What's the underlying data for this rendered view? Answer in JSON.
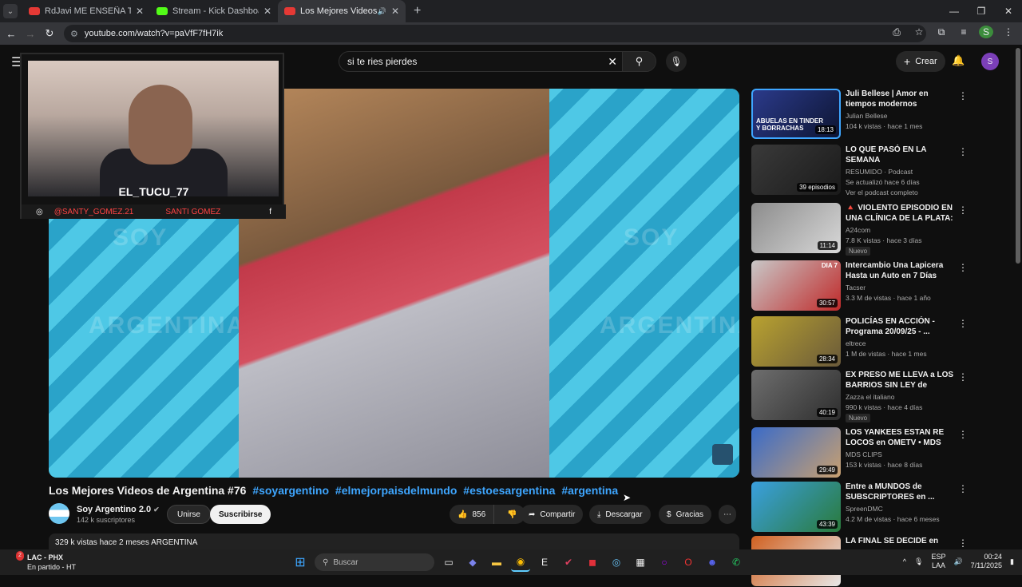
{
  "browser": {
    "tabs": [
      {
        "label": "RdJavi ME ENSEÑA TODA SU C...",
        "color": "#e53935"
      },
      {
        "label": "Stream - Kick Dashboard",
        "color": "#53fc18"
      },
      {
        "label": "Los Mejores Videos de Arg...",
        "color": "#e53935"
      }
    ],
    "url": "youtube.com/watch?v=paVfF7fH7ik",
    "profile": "S"
  },
  "yt": {
    "search_value": "si te ries pierdes",
    "create_label": "Crear",
    "user_initial": "S"
  },
  "overlay": {
    "nickname": "EL_TUCU_77",
    "instagram": "@SANTY_GOMEZ.21",
    "name": "SANTI GOMEZ"
  },
  "video": {
    "title": "Los Mejores Videos de Argentina #76",
    "hashtags": [
      "#soyargentino",
      "#elmejorpaisdelmundo",
      "#estoesargentina",
      "#argentina"
    ],
    "watermark": [
      "SOY",
      "ARGENTINA"
    ],
    "channel": "Soy Argentino 2.0",
    "subscribers": "142 k suscriptores",
    "join_label": "Unirse",
    "subscribe_label": "Suscribirse",
    "likes": "856",
    "share_label": "Compartir",
    "download_label": "Descargar",
    "thanks_label": "Gracias",
    "desc_line": "329 k vistas  hace 2 meses  ARGENTINA"
  },
  "sidebar": [
    {
      "title": "Juli Bellese | Amor en tiempos modernos",
      "channel": "Julian Bellese",
      "meta": "104 k vistas · hace 1 mes",
      "duration": "18:13",
      "thumb_text": "ABUELAS EN TINDER Y BORRACHAS",
      "colors": [
        "#2b3a8a",
        "#0d1533"
      ]
    },
    {
      "title": "LO QUE PASÓ EN LA SEMANA",
      "channel": "RESUMIDO · Podcast",
      "meta": "Se actualizó hace 6 días",
      "extra": "Ver el podcast completo",
      "duration": "39 episodios",
      "colors": [
        "#3a3a3a",
        "#1a1a1a"
      ]
    },
    {
      "title": "🔺 VIOLENTO EPISODIO EN UNA CLÍNICA DE LA PLATA: ...",
      "channel": "A24com",
      "meta": "7.8 K vistas · hace 3 días",
      "badge": "Nuevo",
      "duration": "11:14",
      "colors": [
        "#8c8c8c",
        "#d8d8d8"
      ]
    },
    {
      "title": "Intercambio Una Lapicera Hasta un Auto en 7 Días",
      "channel": "Tacser",
      "meta": "3.3 M de vistas · hace 1 año",
      "duration": "30:57",
      "thumb_text": "DIA 7",
      "colors": [
        "#c8c8c8",
        "#c02a2a"
      ]
    },
    {
      "title": "POLICÍAS EN ACCIÓN - Programa 20/09/25 - ...",
      "channel": "eltrece",
      "meta": "1 M de vistas · hace 1 mes",
      "duration": "28:34",
      "colors": [
        "#b9a230",
        "#6a5a3a"
      ]
    },
    {
      "title": "EX PRESO ME LLEVA a LOS BARRIOS SIN LEY de ROSARIO...",
      "channel": "Zazza el italiano",
      "meta": "990 k vistas · hace 4 días",
      "badge": "Nuevo",
      "duration": "40:19",
      "colors": [
        "#6e6e6e",
        "#2e2e2e"
      ]
    },
    {
      "title": "LOS YANKEES ESTAN RE LOCOS en OMETV • MDS CLIPS",
      "channel": "MDS CLIPS",
      "meta": "153 k vistas · hace 8 días",
      "duration": "29:49",
      "colors": [
        "#3a6bc8",
        "#c8a070"
      ]
    },
    {
      "title": "Entre a MUNDOS de SUBSCRIPTORES en ...",
      "channel": "SpreenDMC",
      "meta": "4.2 M de vistas · hace 6 meses",
      "duration": "43:39",
      "colors": [
        "#3aa0e0",
        "#2a7a3a"
      ]
    },
    {
      "title": "LA FINAL SE DECIDE en",
      "channel": "",
      "meta": "",
      "duration": "",
      "colors": [
        "#d06020",
        "#e8e8e8"
      ]
    }
  ],
  "taskbar": {
    "weather_title": "LAC - PHX",
    "weather_sub": "En partido - HT",
    "weather_badge": "2",
    "search_placeholder": "Buscar",
    "lang1": "ESP",
    "lang2": "LAA",
    "time": "00:24",
    "date": "7/11/2025"
  }
}
